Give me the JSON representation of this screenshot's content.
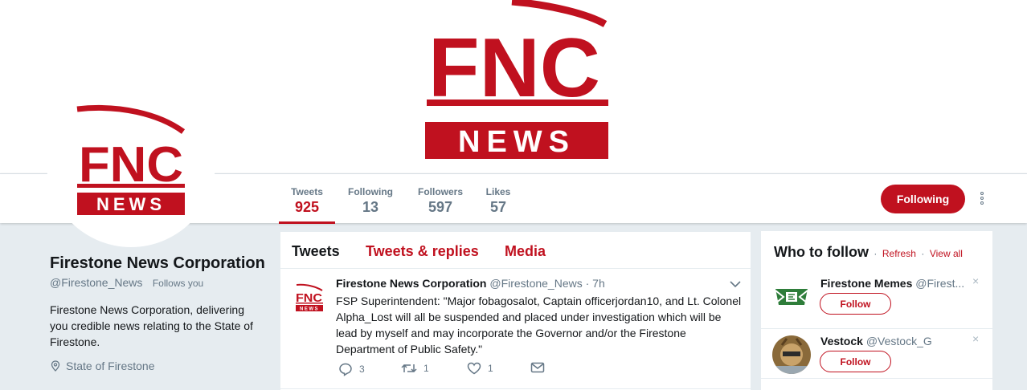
{
  "brand": {
    "logo_top": "FNC",
    "logo_bottom": "NEWS",
    "accent": "#c0111f"
  },
  "nav": {
    "stats": [
      {
        "label": "Tweets",
        "value": "925"
      },
      {
        "label": "Following",
        "value": "13"
      },
      {
        "label": "Followers",
        "value": "597"
      },
      {
        "label": "Likes",
        "value": "57"
      }
    ],
    "following_button": "Following",
    "more_icon": "more-vertical-icon"
  },
  "profile": {
    "name": "Firestone News Corporation",
    "handle": "@Firestone_News",
    "follows_you": "Follows you",
    "bio": "Firestone News Corporation, delivering you credible news relating to the State of Firestone.",
    "location": "State of Firestone"
  },
  "timeline": {
    "tabs": [
      "Tweets",
      "Tweets & replies",
      "Media"
    ],
    "tweet": {
      "name": "Firestone News Corporation",
      "handle": "@Firestone_News",
      "time": "· 7h",
      "text": "FSP Superintendent: \"Major fobagosalot, Captain officerjordan10, and Lt. Colonel Alpha_Lost will all be suspended and placed under investigation which will be lead by myself and may incorporate the Governor and/or the Firestone Department of Public Safety.\"",
      "replies": "3",
      "retweets": "1",
      "likes": "1"
    }
  },
  "who_to_follow": {
    "title": "Who to follow",
    "separator": "·",
    "refresh": "Refresh",
    "view_all": "View all",
    "suggestions": [
      {
        "name": "Firestone Memes",
        "handle": "@Firest...",
        "button": "Follow"
      },
      {
        "name": "Vestock",
        "handle": "@Vestock_G",
        "button": "Follow"
      }
    ],
    "close_glyph": "×"
  }
}
